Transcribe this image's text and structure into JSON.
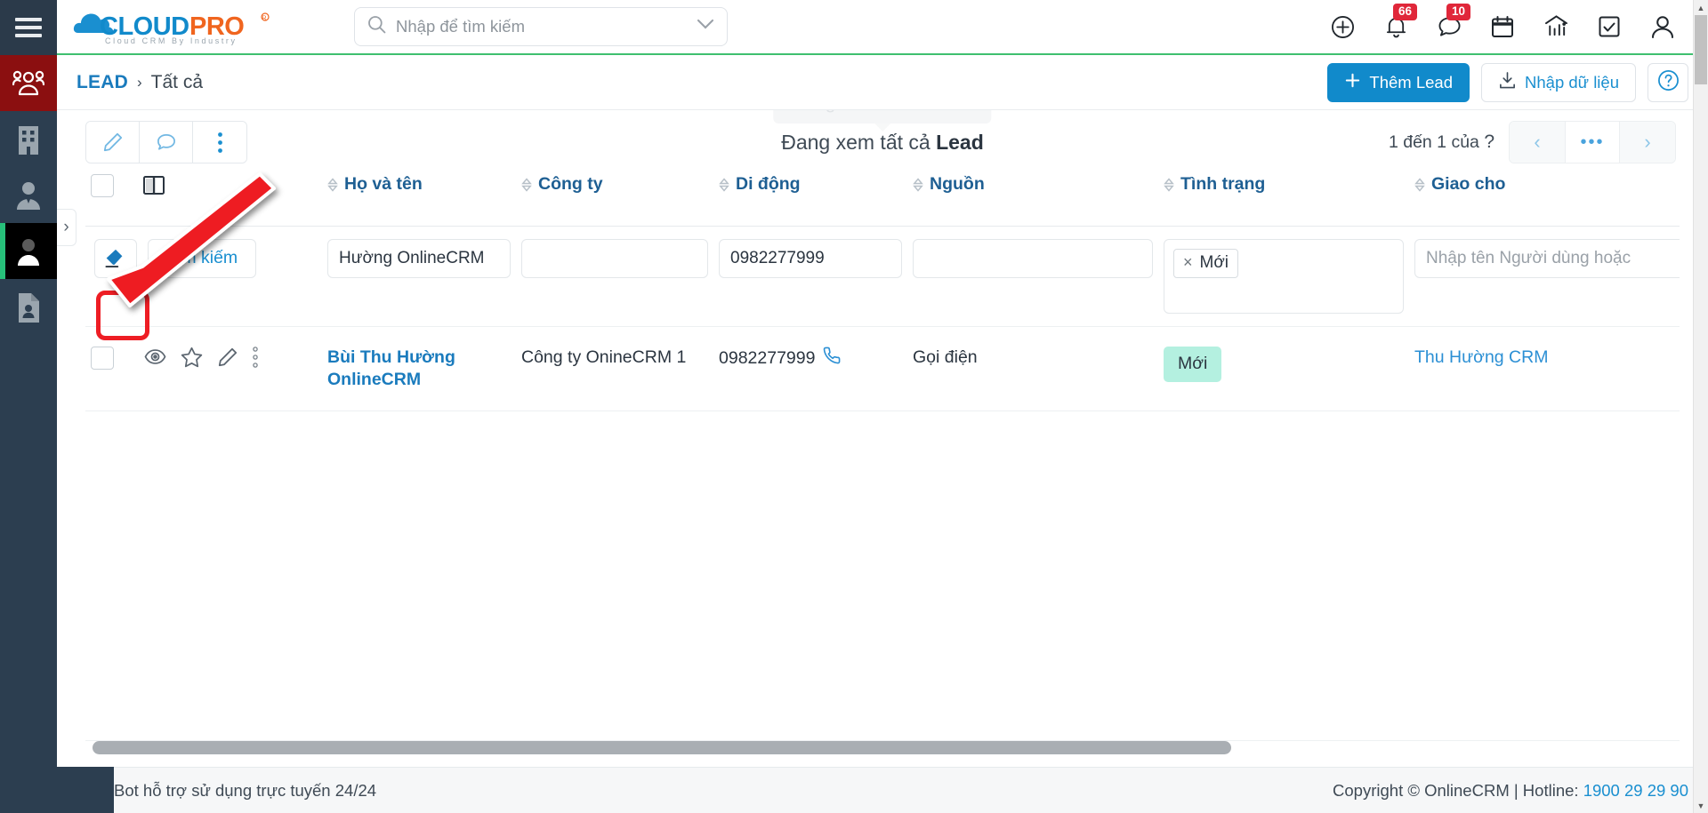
{
  "brand": {
    "name_cloud": "CLOUD",
    "name_pro": "PRO",
    "tagline": "Cloud CRM By Industry",
    "accent_blue": "#118acb",
    "accent_orange": "#f0651f",
    "green_rule": "#3fbf6f"
  },
  "header": {
    "menu_icon": "hamburger-icon",
    "search_placeholder": "Nhập để tìm kiếm",
    "search_value": "",
    "icons": [
      {
        "name": "add-circle-icon",
        "badge": ""
      },
      {
        "name": "bell-icon",
        "badge": "66"
      },
      {
        "name": "chat-icon",
        "badge": "10"
      },
      {
        "name": "calendar-icon",
        "badge": ""
      },
      {
        "name": "analytics-icon",
        "badge": ""
      },
      {
        "name": "task-check-icon",
        "badge": ""
      },
      {
        "name": "user-account-icon",
        "badge": ""
      }
    ]
  },
  "breadcrumb": {
    "module": "LEAD",
    "separator": "›",
    "current": "Tất cả"
  },
  "actions": {
    "add_lead": "Thêm Lead",
    "import": "Nhập dữ liệu",
    "help": "?"
  },
  "toolbar": {
    "buttons": [
      {
        "name": "edit-pencil-icon"
      },
      {
        "name": "comment-icon"
      },
      {
        "name": "more-vertical-icon"
      }
    ],
    "view_title_prefix": "Đang xem tất cả ",
    "view_title_strong": "Lead",
    "ghost_tooltip": "Đang xem tất cả Lead"
  },
  "pagination": {
    "range_text": "1 đến 1 của",
    "total": "?",
    "prev": "‹",
    "more": "•••",
    "next": "›"
  },
  "table": {
    "columns": [
      {
        "key": "select",
        "label": "",
        "icon": "select-all-checkbox"
      },
      {
        "key": "actions",
        "label": "",
        "icon": "column-layout-icon"
      },
      {
        "key": "name",
        "label": "Họ và tên",
        "sortable": true
      },
      {
        "key": "company",
        "label": "Công ty",
        "sortable": true
      },
      {
        "key": "mobile",
        "label": "Di động",
        "sortable": true
      },
      {
        "key": "source",
        "label": "Nguồn",
        "sortable": true
      },
      {
        "key": "status",
        "label": "Tình trạng",
        "sortable": true
      },
      {
        "key": "assigned",
        "label": "Giao cho",
        "sortable": true
      }
    ],
    "filters": {
      "clear_icon": "eraser-clear-icon",
      "search_button": "Tìm kiếm",
      "name_value": "Hường OnlineCRM",
      "company_value": "",
      "mobile_value": "0982277999",
      "source_value": "",
      "status_tags": [
        "Mới"
      ],
      "assigned_placeholder": "Nhập tên Người dùng hoặc"
    },
    "rows": [
      {
        "row_icons": [
          "view-eye-icon",
          "favorite-star-icon",
          "edit-pencil-icon",
          "row-more-icon"
        ],
        "name": "Bùi Thu Hường OnlineCRM",
        "company": "Công ty OnineCRM 1",
        "mobile": "0982277999",
        "mobile_icon": "phone-call-icon",
        "source": "Gọi điện",
        "status": "Mới",
        "status_bg": "#b4f0e0",
        "assigned": "Thu Hường CRM"
      }
    ]
  },
  "sidebar": {
    "items": [
      {
        "name": "sidebar-item-leads-group",
        "icon": "people-group-icon",
        "active_color": "#8b0f10"
      },
      {
        "name": "sidebar-item-company",
        "icon": "building-icon",
        "active_color": ""
      },
      {
        "name": "sidebar-item-contact",
        "icon": "person-tie-icon",
        "active_color": ""
      },
      {
        "name": "sidebar-item-lead",
        "icon": "person-icon",
        "active_color": "#000000"
      },
      {
        "name": "sidebar-item-document",
        "icon": "document-person-icon",
        "active_color": ""
      }
    ],
    "expand_handle": "›"
  },
  "footer": {
    "bot_text": "Bot hỗ trợ sử dụng trực tuyến 24/24",
    "bot_icon": "messenger-icon",
    "copyright": "Copyright © OnlineCRM | Hotline: ",
    "hotline": "1900 29 29 90"
  },
  "annotation": {
    "arrow_color": "#ee1d24",
    "highlight_target": "eraser-clear-icon"
  }
}
